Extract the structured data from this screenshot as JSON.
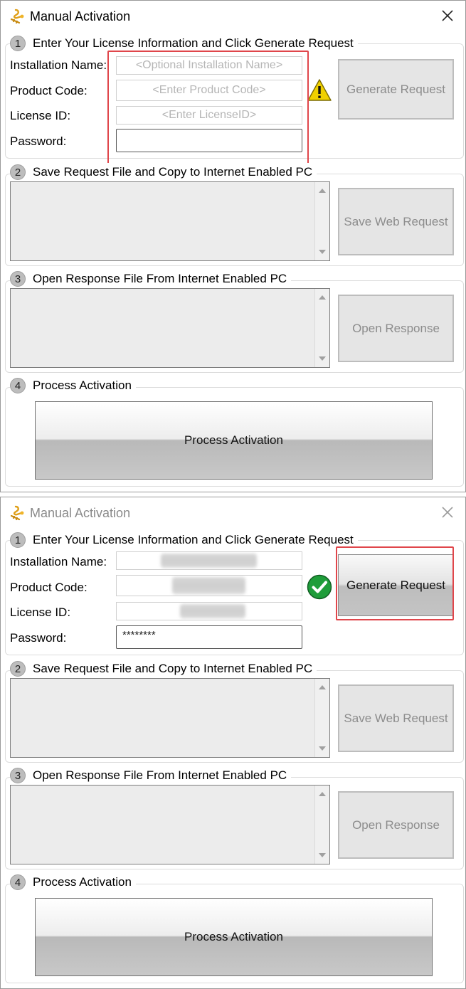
{
  "colors": {
    "highlight": "#e0464b",
    "warning": "#f0d000",
    "success": "#1f9d3a"
  },
  "step_labels": {
    "step1": "Enter Your License Information and Click Generate Request",
    "step2": "Save Request File and Copy to Internet Enabled PC",
    "step3": "Open Response File From Internet Enabled PC",
    "step4": "Process Activation"
  },
  "step_numbers": [
    "1",
    "2",
    "3",
    "4"
  ],
  "field_labels": {
    "installation_name": "Installation Name:",
    "product_code": "Product Code:",
    "license_id": "License ID:",
    "password": "Password:"
  },
  "buttons": {
    "generate_request": "Generate Request",
    "save_web_request": "Save Web Request",
    "open_response": "Open Response",
    "process_activation": "Process Activation"
  },
  "window_before": {
    "title": "Manual Activation",
    "status_icon": "warning-icon",
    "placeholders": {
      "installation_name": "<Optional Installation Name>",
      "product_code": "<Enter Product Code>",
      "license_id": "<Enter LicenseID>"
    },
    "password_value": ""
  },
  "window_after": {
    "title": "Manual Activation",
    "status_icon": "checkmark-icon",
    "password_value": "********"
  }
}
